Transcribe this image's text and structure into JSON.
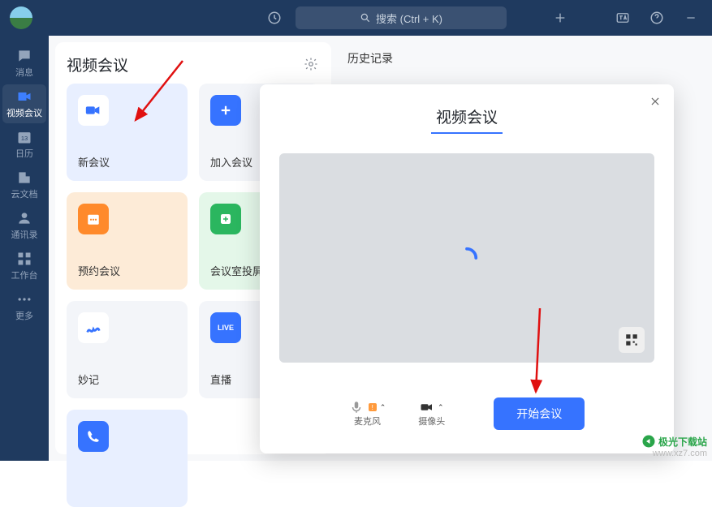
{
  "topbar": {
    "search_placeholder": "搜索 (Ctrl + K)"
  },
  "sidebar": {
    "items": [
      {
        "label": "消息"
      },
      {
        "label": "视频会议"
      },
      {
        "label": "日历"
      },
      {
        "label": "云文档"
      },
      {
        "label": "通讯录"
      },
      {
        "label": "工作台"
      },
      {
        "label": "更多"
      }
    ]
  },
  "panel": {
    "title": "视频会议",
    "history_title": "历史记录",
    "cards": {
      "new": "新会议",
      "join": "加入会议",
      "schedule": "预约会议",
      "room": "会议室投屏",
      "notes": "妙记",
      "live": "直播"
    }
  },
  "modal": {
    "title": "视频会议",
    "mic": "麦克风",
    "camera": "摄像头",
    "start": "开始会议"
  },
  "watermark": {
    "name": "极光下载站",
    "url": "www.xz7.com"
  }
}
